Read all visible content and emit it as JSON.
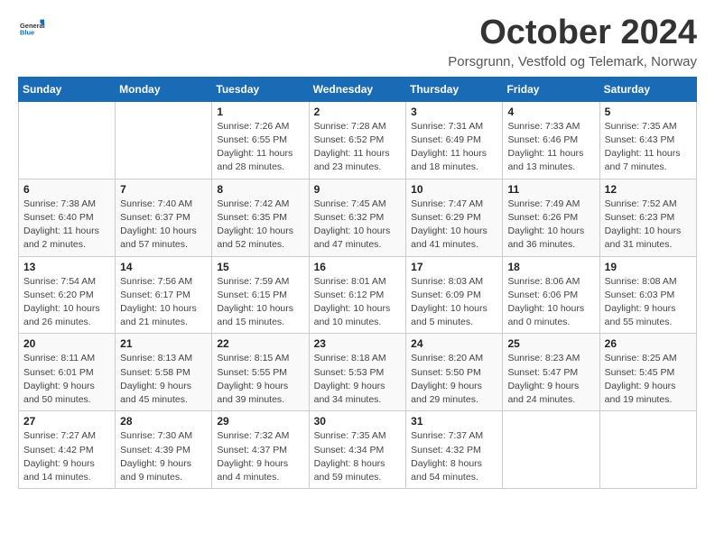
{
  "header": {
    "logo_general": "General",
    "logo_blue": "Blue",
    "title": "October 2024",
    "subtitle": "Porsgrunn, Vestfold og Telemark, Norway"
  },
  "weekdays": [
    "Sunday",
    "Monday",
    "Tuesday",
    "Wednesday",
    "Thursday",
    "Friday",
    "Saturday"
  ],
  "weeks": [
    [
      {
        "day": "",
        "detail": ""
      },
      {
        "day": "",
        "detail": ""
      },
      {
        "day": "1",
        "detail": "Sunrise: 7:26 AM\nSunset: 6:55 PM\nDaylight: 11 hours\nand 28 minutes."
      },
      {
        "day": "2",
        "detail": "Sunrise: 7:28 AM\nSunset: 6:52 PM\nDaylight: 11 hours\nand 23 minutes."
      },
      {
        "day": "3",
        "detail": "Sunrise: 7:31 AM\nSunset: 6:49 PM\nDaylight: 11 hours\nand 18 minutes."
      },
      {
        "day": "4",
        "detail": "Sunrise: 7:33 AM\nSunset: 6:46 PM\nDaylight: 11 hours\nand 13 minutes."
      },
      {
        "day": "5",
        "detail": "Sunrise: 7:35 AM\nSunset: 6:43 PM\nDaylight: 11 hours\nand 7 minutes."
      }
    ],
    [
      {
        "day": "6",
        "detail": "Sunrise: 7:38 AM\nSunset: 6:40 PM\nDaylight: 11 hours\nand 2 minutes."
      },
      {
        "day": "7",
        "detail": "Sunrise: 7:40 AM\nSunset: 6:37 PM\nDaylight: 10 hours\nand 57 minutes."
      },
      {
        "day": "8",
        "detail": "Sunrise: 7:42 AM\nSunset: 6:35 PM\nDaylight: 10 hours\nand 52 minutes."
      },
      {
        "day": "9",
        "detail": "Sunrise: 7:45 AM\nSunset: 6:32 PM\nDaylight: 10 hours\nand 47 minutes."
      },
      {
        "day": "10",
        "detail": "Sunrise: 7:47 AM\nSunset: 6:29 PM\nDaylight: 10 hours\nand 41 minutes."
      },
      {
        "day": "11",
        "detail": "Sunrise: 7:49 AM\nSunset: 6:26 PM\nDaylight: 10 hours\nand 36 minutes."
      },
      {
        "day": "12",
        "detail": "Sunrise: 7:52 AM\nSunset: 6:23 PM\nDaylight: 10 hours\nand 31 minutes."
      }
    ],
    [
      {
        "day": "13",
        "detail": "Sunrise: 7:54 AM\nSunset: 6:20 PM\nDaylight: 10 hours\nand 26 minutes."
      },
      {
        "day": "14",
        "detail": "Sunrise: 7:56 AM\nSunset: 6:17 PM\nDaylight: 10 hours\nand 21 minutes."
      },
      {
        "day": "15",
        "detail": "Sunrise: 7:59 AM\nSunset: 6:15 PM\nDaylight: 10 hours\nand 15 minutes."
      },
      {
        "day": "16",
        "detail": "Sunrise: 8:01 AM\nSunset: 6:12 PM\nDaylight: 10 hours\nand 10 minutes."
      },
      {
        "day": "17",
        "detail": "Sunrise: 8:03 AM\nSunset: 6:09 PM\nDaylight: 10 hours\nand 5 minutes."
      },
      {
        "day": "18",
        "detail": "Sunrise: 8:06 AM\nSunset: 6:06 PM\nDaylight: 10 hours\nand 0 minutes."
      },
      {
        "day": "19",
        "detail": "Sunrise: 8:08 AM\nSunset: 6:03 PM\nDaylight: 9 hours\nand 55 minutes."
      }
    ],
    [
      {
        "day": "20",
        "detail": "Sunrise: 8:11 AM\nSunset: 6:01 PM\nDaylight: 9 hours\nand 50 minutes."
      },
      {
        "day": "21",
        "detail": "Sunrise: 8:13 AM\nSunset: 5:58 PM\nDaylight: 9 hours\nand 45 minutes."
      },
      {
        "day": "22",
        "detail": "Sunrise: 8:15 AM\nSunset: 5:55 PM\nDaylight: 9 hours\nand 39 minutes."
      },
      {
        "day": "23",
        "detail": "Sunrise: 8:18 AM\nSunset: 5:53 PM\nDaylight: 9 hours\nand 34 minutes."
      },
      {
        "day": "24",
        "detail": "Sunrise: 8:20 AM\nSunset: 5:50 PM\nDaylight: 9 hours\nand 29 minutes."
      },
      {
        "day": "25",
        "detail": "Sunrise: 8:23 AM\nSunset: 5:47 PM\nDaylight: 9 hours\nand 24 minutes."
      },
      {
        "day": "26",
        "detail": "Sunrise: 8:25 AM\nSunset: 5:45 PM\nDaylight: 9 hours\nand 19 minutes."
      }
    ],
    [
      {
        "day": "27",
        "detail": "Sunrise: 7:27 AM\nSunset: 4:42 PM\nDaylight: 9 hours\nand 14 minutes."
      },
      {
        "day": "28",
        "detail": "Sunrise: 7:30 AM\nSunset: 4:39 PM\nDaylight: 9 hours\nand 9 minutes."
      },
      {
        "day": "29",
        "detail": "Sunrise: 7:32 AM\nSunset: 4:37 PM\nDaylight: 9 hours\nand 4 minutes."
      },
      {
        "day": "30",
        "detail": "Sunrise: 7:35 AM\nSunset: 4:34 PM\nDaylight: 8 hours\nand 59 minutes."
      },
      {
        "day": "31",
        "detail": "Sunrise: 7:37 AM\nSunset: 4:32 PM\nDaylight: 8 hours\nand 54 minutes."
      },
      {
        "day": "",
        "detail": ""
      },
      {
        "day": "",
        "detail": ""
      }
    ]
  ]
}
